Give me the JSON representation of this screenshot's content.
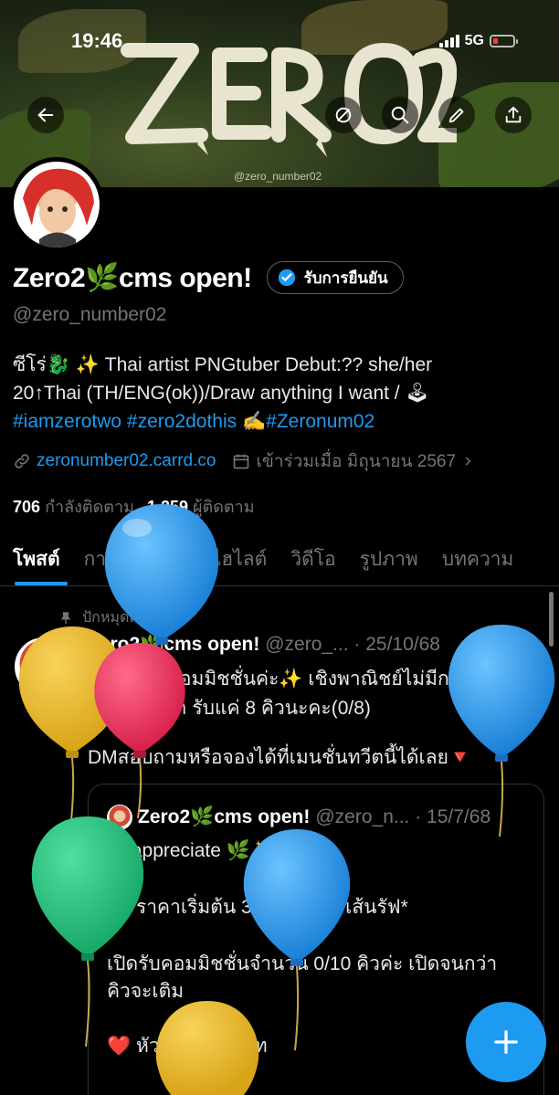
{
  "status_bar": {
    "time": "19:46",
    "network": "5G"
  },
  "banner": {
    "logo_text": "ZERO2",
    "watermark": "@zero_number02"
  },
  "profile": {
    "name": "Zero2🌿cms open!",
    "verify_button": "รับการยืนยัน",
    "handle": "@zero_number02",
    "bio_line1": "ซีโร่🐉 ✨ Thai artist PNGtuber Debut:?? she/her",
    "bio_line2": "20↑Thai (TH/ENG(ok))/Draw anything I want / 🕹",
    "bio_tags": [
      "#iamzerotwo",
      "#zero2dothis",
      "✍️",
      "#Zeronum02"
    ],
    "website": "zeronumber02.carrd.co",
    "joined": "เข้าร่วมเมื่อ มิถุนายน 2567",
    "following_count": "706",
    "following_label": "กำลังติดตาม",
    "followers_count": "1,259",
    "followers_label": "ผู้ติดตาม"
  },
  "tabs": [
    "โพสต์",
    "การตอบกลับ",
    "ไฮไลต์",
    "วิดีโอ",
    "รูปภาพ",
    "บทความ"
  ],
  "post": {
    "pinned_label": "ปักหมุดแล้ว",
    "author": "Zero2🌿cms open!",
    "handle_date": "@zero_... · 25/10/68",
    "line1": "ปรับราคาคอมมิชชั่นค่ะ✨ เชิงพาณิชย์ไม่มีการ",
    "line2": "เพิ่ม 1.5 เท่า รับแค่ 8 คิวนะคะ(0/8)",
    "line3": "DMสอบถามหรือจองได้ที่เมนชั่นทวีตนี้ได้เลย🔻",
    "quote": {
      "author": "Zero2🌿cms open!",
      "handle_date": "@zero_n... · 15/7/68",
      "line1": "Rt appreciate 🌿✨",
      "line2": "💚 ราคาเริ่มต้น 370 บาท💙*เส้นรัฟ*",
      "line3": "เปิดรับคอมมิชชั่นจำนวน 0/10 คิวค่ะ เปิดจนกว่า",
      "line4": "คิวจะเติม",
      "line5": "❤️ หัว-อก 370 บาท"
    }
  },
  "colors": {
    "accent": "#1d9bf0",
    "background": "#000000"
  }
}
